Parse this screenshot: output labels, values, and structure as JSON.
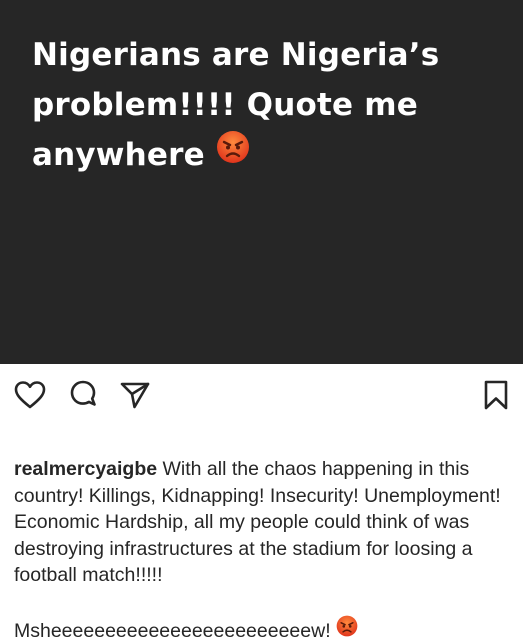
{
  "post": {
    "image_text": "Nigerians are Nigeria’s problem!!!! Quote me anywhere",
    "image_emoji": "angry-face-emoji",
    "background": "#262626"
  },
  "actions": {
    "like_icon": "heart-icon",
    "comment_icon": "comment-icon",
    "share_icon": "share-icon",
    "save_icon": "bookmark-icon"
  },
  "caption": {
    "username": "realmercyaigbe",
    "text": "With all the chaos happening in this country! Killings, Kidnapping! Insecurity! Unemployment! Economic Hardship, all my people could think of was destroying infrastructures at the stadium for loosing a football match!!!!!",
    "second_line": "Msheeeeeeeeeeeeeeeeeeeeeeeew!",
    "emoji": "angry-face-emoji"
  }
}
